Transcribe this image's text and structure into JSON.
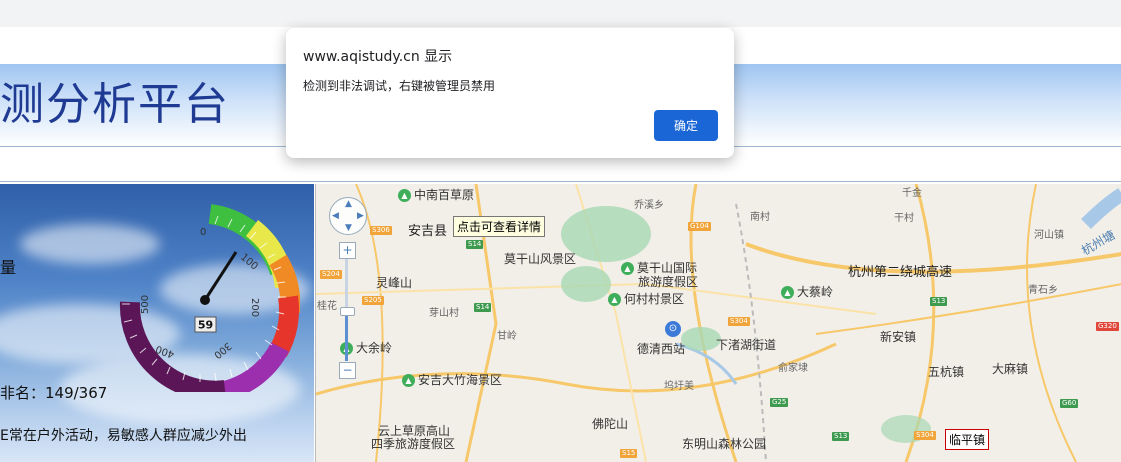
{
  "dialog": {
    "origin": "www.aqistudy.cn 显示",
    "message": "检测到非法调试，右键被管理员禁用",
    "ok_label": "确定"
  },
  "header": {
    "title": "测分析平台"
  },
  "aqi": {
    "quality_label": "量",
    "aqi_value": "59",
    "rank_text": "非名：149/367",
    "advice": "E常在户外活动，易敏感人群应减少外出",
    "gauge_ticks": [
      "0",
      "100",
      "200",
      "300",
      "400",
      "500"
    ]
  },
  "map": {
    "tooltip": "点击可查看详情",
    "town_label": "临平镇",
    "zoom_in": "+",
    "zoom_out": "−",
    "places": {
      "zhongnan": "中南百草原",
      "anji": "安吉县",
      "moganshan_scenic": "莫干山风景区",
      "moganshan_resort_1": "莫干山国际",
      "moganshan_resort_2": "旅游度假区",
      "hecun": "何村村景区",
      "lingfengshan": "灵峰山",
      "yashancun": "芽山村",
      "guihua": "桂花",
      "ganling": "甘岭",
      "dayuling": "大余岭",
      "anji_bamboo": "安吉大竹海景区",
      "yunshang_1": "云上草原高山",
      "yunshang_2": "四季旅游度假区",
      "foshan": "佛陀山",
      "dongming": "东明山森林公园",
      "deqing_west": "德清西站",
      "xiazhuhu": "下渚湖街道",
      "wuqiao": "坞圩美",
      "yujiadai": "俞家埭",
      "nancun": "南村",
      "qianxi": "乔溪乡",
      "dacailing": "大蔡岭",
      "xinanzhen": "新安镇",
      "wukangzhen": "五杭镇",
      "damazhen": "大麻镇",
      "hangzhou_ring": "杭州第二绕城高速",
      "qianjin": "千金",
      "ganshan": "干村",
      "heshan": "河山镇",
      "qingshi": "青石乡",
      "hangzhou_tang": "杭州塘"
    },
    "roads": [
      "S306",
      "S14",
      "S204",
      "S205",
      "S14",
      "G104",
      "S304",
      "G25",
      "S13",
      "S13",
      "S304",
      "G320",
      "G60",
      "S15"
    ]
  }
}
